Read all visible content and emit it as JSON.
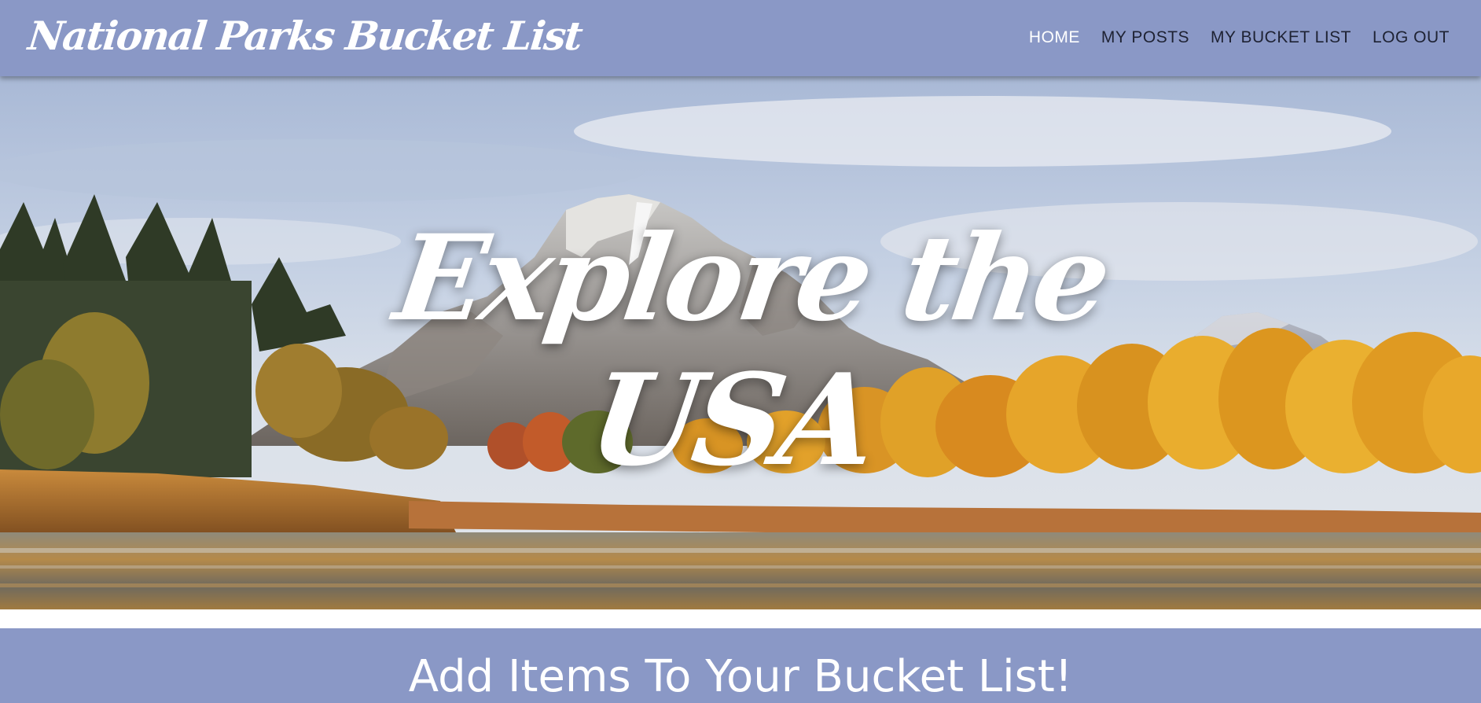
{
  "navbar": {
    "brand": "National Parks Bucket List",
    "links": [
      {
        "label": "HOME",
        "active": true
      },
      {
        "label": "MY POSTS",
        "active": false
      },
      {
        "label": "MY BUCKET LIST",
        "active": false
      },
      {
        "label": "LOG OUT",
        "active": false
      }
    ]
  },
  "hero": {
    "line1": "Explore the",
    "line2": "USA"
  },
  "section": {
    "heading": "Add Items To Your Bucket List!"
  },
  "colors": {
    "nav_bg": "#8a98c6",
    "nav_link": "#1e2233",
    "nav_link_active": "#ffffff",
    "section_bg": "#8a98c6"
  }
}
